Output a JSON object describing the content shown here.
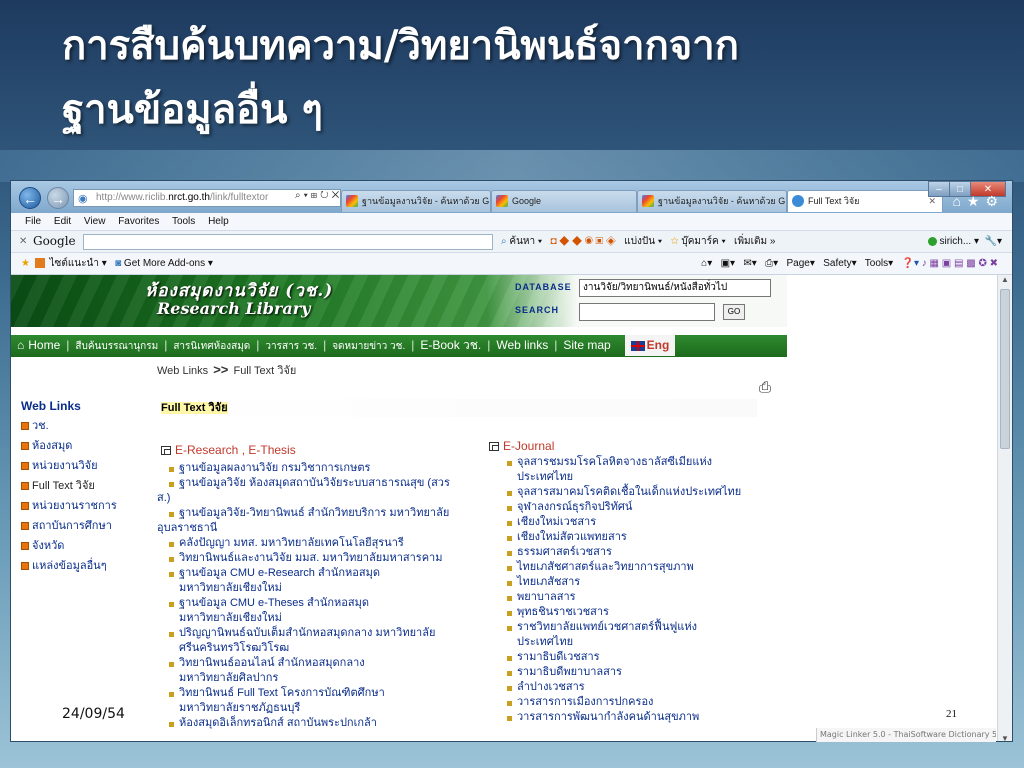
{
  "slide": {
    "title_line1": "การสืบค้นบทความ/วิทยานิพนธ์จากจาก",
    "title_line2": "ฐานข้อมูลอื่น ๆ",
    "date": "24/09/54",
    "page_number": "21"
  },
  "browser": {
    "address": {
      "prefix": "http://www.riclib.",
      "host": "nrct.go.th",
      "path": "/link/fulltextor"
    },
    "tabs": [
      {
        "label": "ฐานข้อมูลงานวิจัย - ค้นหาด้วย G...",
        "icon": "google-icon"
      },
      {
        "label": "Google",
        "icon": "google-icon"
      },
      {
        "label": "ฐานข้อมูลงานวิจัย - ค้นหาด้วย G...",
        "icon": "google-icon"
      },
      {
        "label": "Full Text วิจัย",
        "icon": "ie-icon",
        "active": true
      }
    ],
    "menu": [
      "File",
      "Edit",
      "View",
      "Favorites",
      "Tools",
      "Help"
    ],
    "google_bar": {
      "logo": "Google",
      "search_btn": "ค้นหา",
      "share": "แบ่งปัน",
      "bookmarks": "บุ๊คมาร์ค",
      "more": "เพิ่มเติม »",
      "user": "sirich..."
    },
    "fav_bar": {
      "suggested": "ไซต์แนะนำ",
      "addons": "Get More Add-ons",
      "page": "Page",
      "safety": "Safety",
      "tools": "Tools"
    },
    "status": "Magic Linker 5.0 - ThaiSoftware Dictionary 5.0"
  },
  "site": {
    "banner_thai": "ห้องสมุดงานวิจัย (วช.)",
    "banner_en": "Research Library",
    "db_label": "DATABASE",
    "search_label": "SEARCH",
    "db_selected": "งานวิจัย/วิทยานิพนธ์/หนังสือทั่วไป",
    "go": "GO",
    "nav": {
      "home": "Home",
      "items": [
        "สืบค้นบรรณานุกรม",
        "สารนิเทศห้องสมุด",
        "วารสาร วช.",
        "จดหมายข่าว วช.",
        "E-Book วช.",
        "Web links",
        "Site map"
      ],
      "eng": "Eng"
    },
    "breadcrumb": {
      "first": "Web Links",
      "sep": ">>",
      "second": "Full Text วิจัย"
    },
    "sidebar": {
      "title": "Web Links",
      "items": [
        "วช.",
        "ห้องสมุด",
        "หน่วยงานวิจัย",
        "Full Text วิจัย",
        "หน่วยงานราชการ",
        "สถาบันการศึกษา",
        "จังหวัด",
        "แหล่งข้อมูลอื่นๆ"
      ]
    },
    "content_title": "Full Text วิจัย",
    "left_col": {
      "heading": "E-Research , E-Thesis",
      "lines": [
        {
          "t": "ฐานข้อมูลผลงานวิจัย  กรมวิชาการเกษตร",
          "b": true
        },
        {
          "t": "ฐานข้อมูลวิจัย  ห้องสมุดสถาบันวิจัยระบบสาธารณสุข  (สวร",
          "b": true
        },
        {
          "t": "ส.)",
          "b": false,
          "out": true
        },
        {
          "t": "ฐานข้อมูลวิจัย-วิทยานิพนธ์  สำนักวิทยบริการ  มหาวิทยาลัย",
          "b": true
        },
        {
          "t": "อุบลราชธานี",
          "b": false,
          "out": true
        },
        {
          "t": "คลังปัญญา  มทส. มหาวิทยาลัยเทคโนโลยีสุรนารี",
          "b": true
        },
        {
          "t": "วิทยานิพนธ์และงานวิจัย  มมส. มหาวิทยาลัยมหาสารคาม",
          "b": true
        },
        {
          "t": "ฐานข้อมูล  CMU e-Research สำนักหอสมุด",
          "b": true
        },
        {
          "t": "มหาวิทยาลัยเชียงใหม่",
          "b": false
        },
        {
          "t": "ฐานข้อมูล  CMU e-Theses สำนักหอสมุด",
          "b": true
        },
        {
          "t": "มหาวิทยาลัยเชียงใหม่",
          "b": false
        },
        {
          "t": "ปริญญานิพนธ์ฉบับเต็มสำนักหอสมุดกลาง  มหาวิทยาลัย",
          "b": true
        },
        {
          "t": "ศรีนครินทรวิโรฒวิโรฒ",
          "b": false
        },
        {
          "t": "วิทยานิพนธ์ออนไลน์  สำนักหอสมุดกลาง",
          "b": true
        },
        {
          "t": "มหาวิทยาลัยศิลปากร",
          "b": false
        },
        {
          "t": "วิทยานิพนธ์  Full Text โครงการบัณฑิตศึกษา",
          "b": true
        },
        {
          "t": "มหาวิทยาลัยราชภัฏธนบุรี",
          "b": false
        },
        {
          "t": "ห้องสมุดอิเล็กทรอนิกส์  สถาบันพระปกเกล้า",
          "b": true
        }
      ]
    },
    "right_col": {
      "heading": "E-Journal",
      "lines": [
        {
          "t": "จุลสารชมรมโรคโลหิตจางธาลัสซีเมียแห่ง",
          "b": true
        },
        {
          "t": "ประเทศไทย",
          "b": false
        },
        {
          "t": "จุลสารสมาคมโรคติดเชื้อในเด็กแห่งประเทศไทย",
          "b": true
        },
        {
          "t": "จุฬาลงกรณ์ธุรกิจปริทัศน์",
          "b": true
        },
        {
          "t": "เชียงใหม่เวชสาร",
          "b": true
        },
        {
          "t": "เชียงใหม่สัตวแพทยสาร",
          "b": true
        },
        {
          "t": "ธรรมศาสตร์เวชสาร",
          "b": true
        },
        {
          "t": "ไทยเภสัชศาสตร์และวิทยาการสุขภาพ",
          "b": true
        },
        {
          "t": "ไทยเภสัชสาร",
          "b": true
        },
        {
          "t": "พยาบาลสาร",
          "b": true
        },
        {
          "t": "พุทธชินราชเวชสาร",
          "b": true
        },
        {
          "t": "ราชวิทยาลัยแพทย์เวชศาสตร์ฟื้นฟูแห่ง",
          "b": true
        },
        {
          "t": "ประเทศไทย",
          "b": false
        },
        {
          "t": "รามาธิบดีเวชสาร",
          "b": true
        },
        {
          "t": "รามาธิบดีพยาบาลสาร",
          "b": true
        },
        {
          "t": "ลำปางเวชสาร",
          "b": true
        },
        {
          "t": "วารสารการเมืองการปกครอง",
          "b": true
        },
        {
          "t": "วารสารการพัฒนากำลังคนด้านสุขภาพ",
          "b": true
        }
      ]
    }
  }
}
